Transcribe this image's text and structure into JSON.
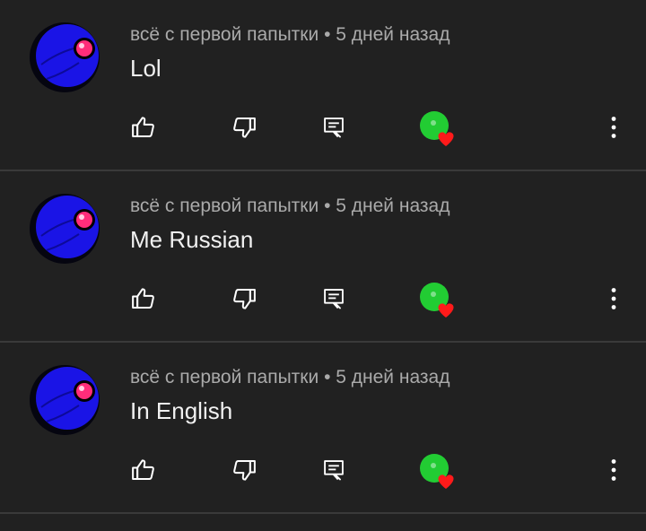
{
  "colors": {
    "background": "#212121",
    "divider": "#3a3a3a",
    "meta_text": "#aaaaaa",
    "comment_text": "#f1f1f1",
    "avatar_blue": "#1a14e6",
    "avatar_eye": "#ff2d7a",
    "creator_green": "#22cc33",
    "heart_red": "#ff1a1a"
  },
  "icons": {
    "like": "thumb-up-icon",
    "dislike": "thumb-down-icon",
    "reply": "reply-icon",
    "hearted": "creator-heart-icon",
    "more": "more-vertical-icon"
  },
  "comments": [
    {
      "author": "всё с первой папытки",
      "separator": "•",
      "time": "5 дней назад",
      "text": "Lol"
    },
    {
      "author": "всё с первой папытки",
      "separator": "•",
      "time": "5 дней назад",
      "text": "Me Russian"
    },
    {
      "author": "всё с первой папытки",
      "separator": "•",
      "time": "5 дней назад",
      "text": "In English"
    }
  ]
}
